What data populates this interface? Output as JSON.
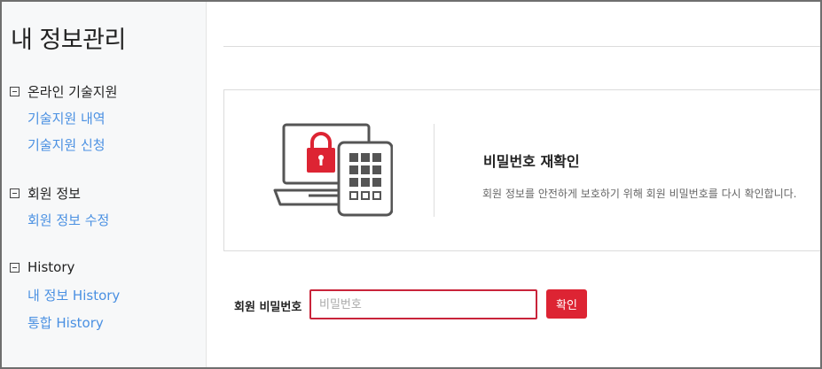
{
  "sidebar": {
    "title": "내 정보관리",
    "groups": [
      {
        "label": "온라인 기술지원",
        "items": [
          "기술지원 내역",
          "기술지원 신청"
        ]
      },
      {
        "label": "회원 정보",
        "items": [
          "회원 정보 수정"
        ]
      },
      {
        "label": "History",
        "items": [
          "내 정보 History",
          "통합 History"
        ]
      }
    ]
  },
  "verify": {
    "title": "비밀번호 재확인",
    "description": "회원 정보를 안전하게 보호하기 위해 회원 비밀번호를 다시 확인합니다."
  },
  "form": {
    "label": "회원 비밀번호",
    "placeholder": "비밀번호",
    "value": "",
    "submit_label": "확인"
  },
  "colors": {
    "accent": "#dd2433",
    "input_border": "#c9243a",
    "link": "#4a90e2",
    "sidebar_bg": "#f7f8f9"
  },
  "icons": {
    "group_toggle": "minus-square-icon",
    "security": "laptop-lock-keypad-icon"
  }
}
